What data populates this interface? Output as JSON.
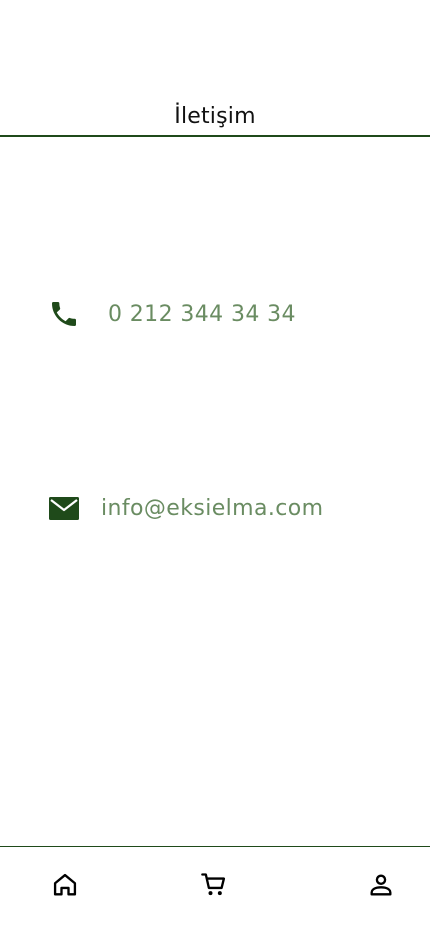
{
  "header": {
    "title": "İletişim"
  },
  "contact": {
    "phone": {
      "icon": "phone-icon",
      "text": "0 212 344 34 34"
    },
    "email": {
      "icon": "mail-icon",
      "text": "info@eksielma.com"
    }
  },
  "tabbar": {
    "items": [
      {
        "icon": "home-icon"
      },
      {
        "icon": "cart-icon"
      },
      {
        "icon": "profile-icon"
      }
    ]
  },
  "colors": {
    "accent": "#1f4a1a",
    "contact_text": "#6a8c62"
  }
}
